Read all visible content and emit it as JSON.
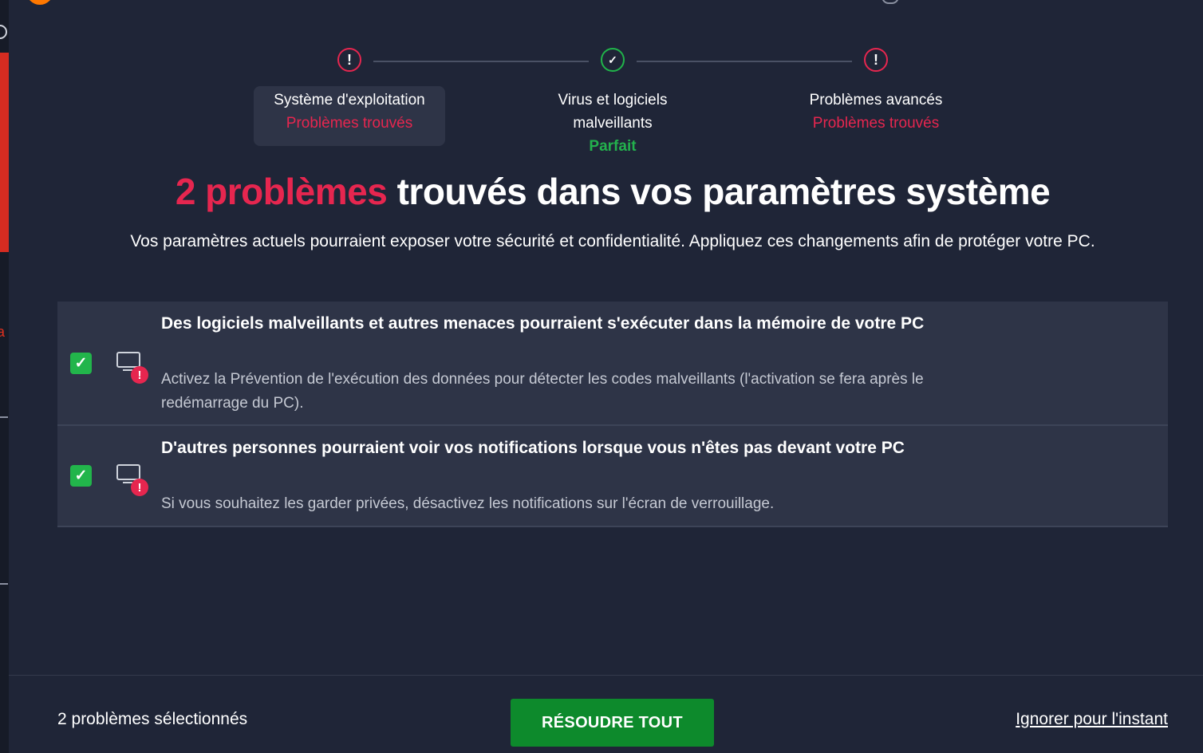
{
  "steps": [
    {
      "label": "Système d'exploitation",
      "status": "Problèmes trouvés"
    },
    {
      "label_line1": "Virus et logiciels",
      "label_line2": "malveillants",
      "status": "Parfait"
    },
    {
      "label": "Problèmes avancés",
      "status": "Problèmes trouvés"
    }
  ],
  "headline": {
    "count": "2 problèmes",
    "rest": " trouvés dans vos paramètres système"
  },
  "subtitle": "Vos paramètres actuels pourraient exposer votre sécurité et confidentialité. Appliquez ces changements afin de protéger votre PC.",
  "issues": [
    {
      "title": "Des logiciels malveillants et autres menaces pourraient s'exécuter dans la mémoire de votre PC",
      "description": "Activez la Prévention de l'exécution des données pour détecter les codes malveillants (l'activation se fera après le redémarrage du PC).",
      "checked": true,
      "icon": "monitor-alert-icon"
    },
    {
      "title": "D'autres personnes pourraient voir vos notifications lorsque vous n'êtes pas devant votre PC",
      "description": "Si vous souhaitez les garder privées, désactivez les notifications sur l'écran de verrouillage.",
      "checked": true,
      "icon": "monitor-alert-icon"
    }
  ],
  "footer": {
    "selected_count": "2 problèmes sélectionnés",
    "resolve_label": "RÉSOUDRE TOUT",
    "ignore_label": "Ignorer pour l'instant"
  },
  "colors": {
    "danger": "#e6264f",
    "success": "#23b14d",
    "button": "#0d8a2c",
    "background": "#1f2537",
    "card": "#2e3447"
  }
}
